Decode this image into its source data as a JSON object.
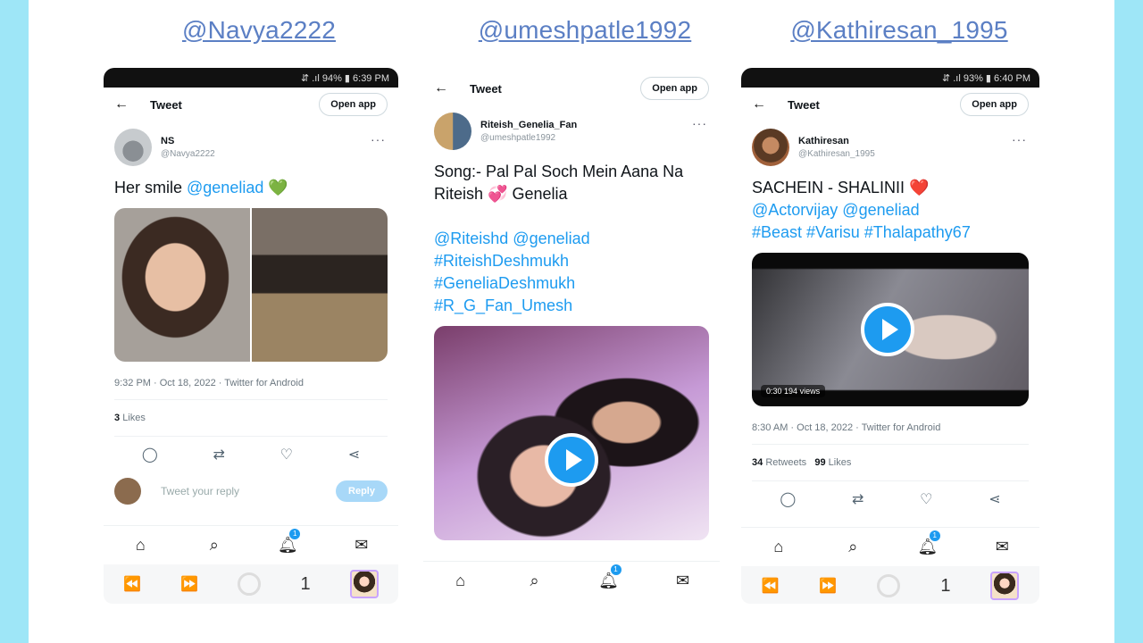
{
  "colors": {
    "background": "#9ee6f7",
    "link": "#1d9bf0",
    "handle": "#5b7fc4"
  },
  "panels": [
    {
      "handle": "@Navya2222",
      "status": "⇵ .ıl 94% ▮ 6:39 PM",
      "header": {
        "title": "Tweet",
        "open_app": "Open app"
      },
      "author": {
        "name": "NS",
        "username": "@Navya2222"
      },
      "text": "Her smile ",
      "mention": "@geneliad",
      "emoji": "💚",
      "meta": "9:32 PM · Oct 18, 2022 · Twitter for Android",
      "stats": {
        "likes_count": "3",
        "likes_label": "Likes"
      },
      "reply_placeholder": "Tweet your reply",
      "reply_button": "Reply"
    },
    {
      "handle": "@umeshpatle1992",
      "header": {
        "title": "Tweet",
        "open_app": "Open app"
      },
      "author": {
        "name": "Riteish_Genelia_Fan",
        "username": "@umeshpatle1992"
      },
      "line1": "Song:- Pal Pal Soch Mein Aana Na",
      "line2a": "Riteish ",
      "emoji": "💞",
      "line2b": " Genelia",
      "links": [
        "@Riteishd @geneliad",
        "#RiteishDeshmukh",
        "#GeneliaDeshmukh",
        "#R_G_Fan_Umesh"
      ]
    },
    {
      "handle": "@Kathiresan_1995",
      "status": "⇵ .ıl 93% ▮ 6:40 PM",
      "header": {
        "title": "Tweet",
        "open_app": "Open app"
      },
      "author": {
        "name": "Kathiresan",
        "username": "@Kathiresan_1995"
      },
      "line1": "SACHEIN - SHALINII ",
      "emoji": "❤️",
      "links": [
        "@Actorvijay @geneliad",
        "#Beast #Varisu #Thalapathy67"
      ],
      "video": {
        "time": "0:30",
        "views": "194 views"
      },
      "meta": "8:30 AM · Oct 18, 2022 · Twitter for Android",
      "stats": {
        "retweets_count": "34",
        "retweets_label": "Retweets",
        "likes_count": "99",
        "likes_label": "Likes"
      }
    }
  ],
  "nav": {
    "notification_badge": "1",
    "tab_count": "1"
  },
  "icons": [
    "back-arrow-icon",
    "home-icon",
    "search-icon",
    "bell-icon",
    "mail-icon",
    "reply-icon",
    "retweet-icon",
    "like-icon",
    "share-icon",
    "play-icon"
  ]
}
